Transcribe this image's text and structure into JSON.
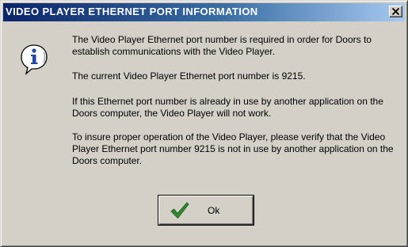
{
  "dialog": {
    "title": "VIDEO PLAYER ETHERNET PORT INFORMATION",
    "close_symbol": "×",
    "icon": "info-icon",
    "messages": [
      "The Video Player Ethernet port number is required in order for Doors to establish communications with the Video Player.",
      "The current Video Player Ethernet port number is 9215.",
      "If this Ethernet port number is already in use by another application on the Doors computer, the Video Player will not work.",
      "To insure proper operation of the Video Player, please verify that the Video Player Ethernet port number 9215 is not in use by another application on the Doors computer."
    ],
    "ok_label": "Ok",
    "ok_icon": "checkmark-icon"
  },
  "colors": {
    "face": "#d4d0c8",
    "title_start": "#0a246a",
    "title_end": "#a6caf0",
    "check_green": "#2e8b2e",
    "info_blue": "#1f4aa8"
  }
}
